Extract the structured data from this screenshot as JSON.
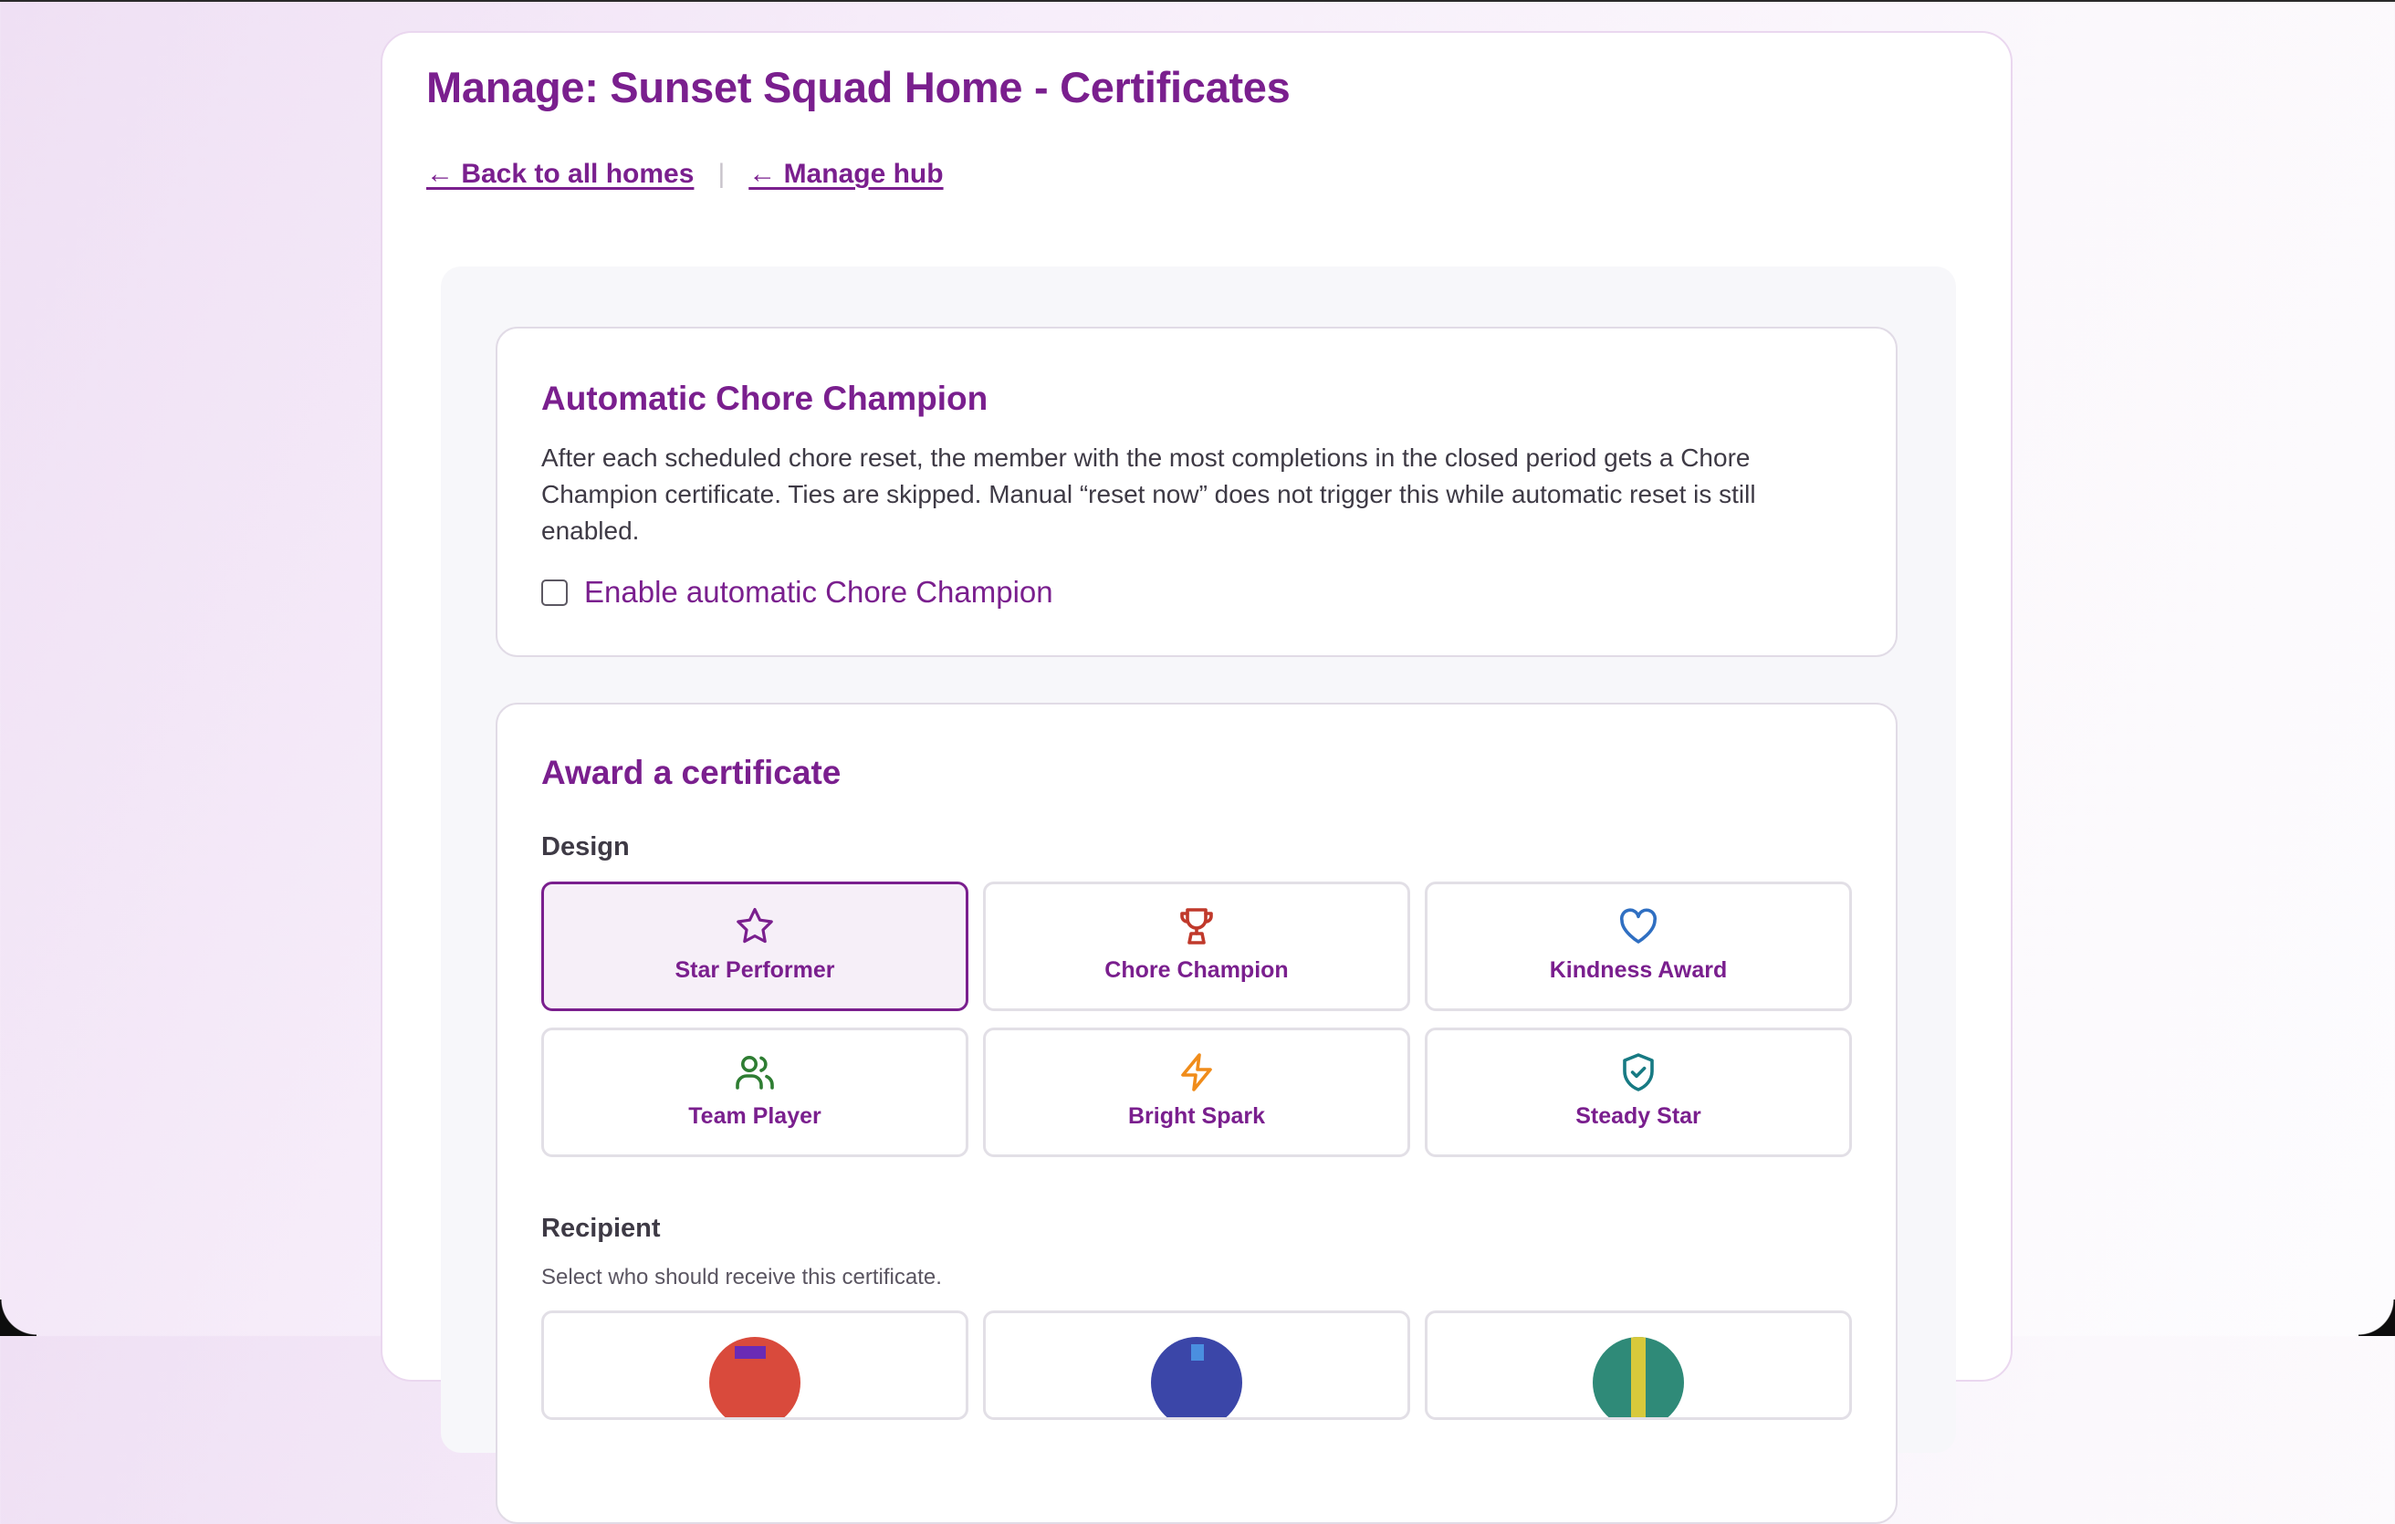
{
  "page": {
    "title": "Manage: Sunset Squad Home - Certificates",
    "nav": {
      "back_label": "← Back to all homes",
      "separator": "|",
      "hub_label": "← Manage hub"
    }
  },
  "auto_champion": {
    "heading": "Automatic Chore Champion",
    "description": "After each scheduled chore reset, the member with the most completions in the closed period gets a Chore Champion certificate. Ties are skipped. Manual “reset now” does not trigger this while automatic reset is still enabled.",
    "checkbox_label": "Enable automatic Chore Champion",
    "checkbox_checked": false
  },
  "award": {
    "heading": "Award a certificate",
    "design_label": "Design",
    "designs": [
      {
        "label": "Star Performer",
        "icon": "star-icon",
        "color": "#7a1f8e",
        "selected": true
      },
      {
        "label": "Chore Champion",
        "icon": "trophy-icon",
        "color": "#c0392b",
        "selected": false
      },
      {
        "label": "Kindness Award",
        "icon": "heart-icon",
        "color": "#2f6fc2",
        "selected": false
      },
      {
        "label": "Team Player",
        "icon": "users-icon",
        "color": "#2e7d32",
        "selected": false
      },
      {
        "label": "Bright Spark",
        "icon": "lightning-icon",
        "color": "#f08c1a",
        "selected": false
      },
      {
        "label": "Steady Star",
        "icon": "shield-check-icon",
        "color": "#177a83",
        "selected": false
      }
    ],
    "recipient_label": "Recipient",
    "recipient_hint": "Select who should receive this certificate."
  },
  "colors": {
    "accent": "#7a1f8e",
    "selected_bg": "#f6eff8"
  }
}
